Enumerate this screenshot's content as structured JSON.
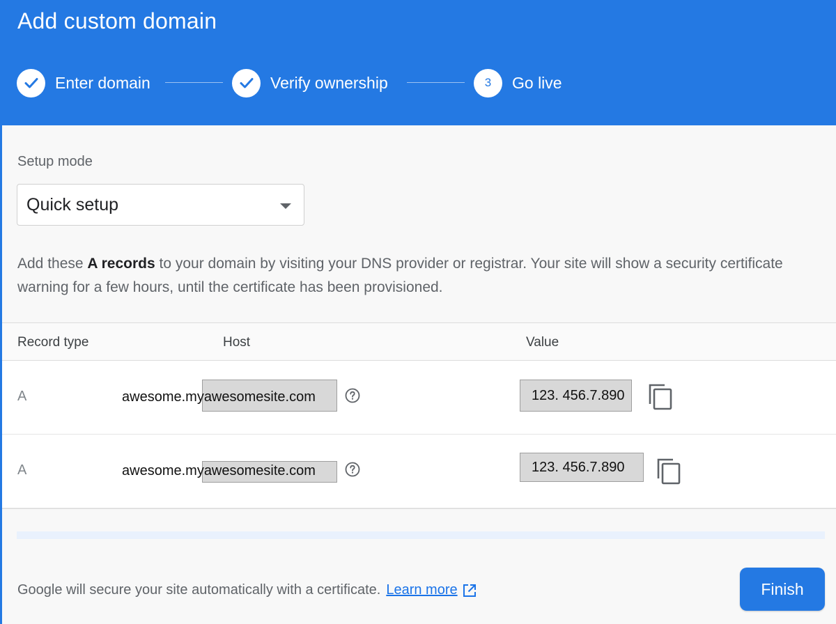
{
  "header": {
    "title": "Add custom domain",
    "steps": [
      {
        "label": "Enter domain",
        "state": "complete"
      },
      {
        "label": "Verify ownership",
        "state": "complete"
      },
      {
        "label": "Go live",
        "state": "current",
        "number": "3"
      }
    ]
  },
  "setup": {
    "label": "Setup mode",
    "selected": "Quick setup"
  },
  "instructions": {
    "prefix": "Add these ",
    "bold": "A records",
    "suffix": " to your domain by visiting your DNS provider or registrar. Your site will show a security certificate warning for a few hours, until the certificate has been provisioned."
  },
  "table": {
    "headers": {
      "type": "Record type",
      "host": "Host",
      "value": "Value"
    },
    "rows": [
      {
        "type": "A",
        "host": "awesome.myawesomesite.com",
        "value": "123. 456.7.890"
      },
      {
        "type": "A",
        "host": "awesome.myawesomesite.com",
        "value": "123. 456.7.890"
      }
    ]
  },
  "footer": {
    "text": "Google will secure your site automatically with a certificate.",
    "link": "Learn more",
    "finish": "Finish"
  },
  "icons": {
    "step_complete": "check-circle-icon",
    "help": "help-circle-icon",
    "copy": "copy-icon",
    "external": "open-in-new-icon",
    "dropdown": "arrow-drop-down-icon"
  },
  "colors": {
    "primary": "#2479e3",
    "link": "#1a73e8",
    "panel_bg": "#f8f8f8"
  }
}
